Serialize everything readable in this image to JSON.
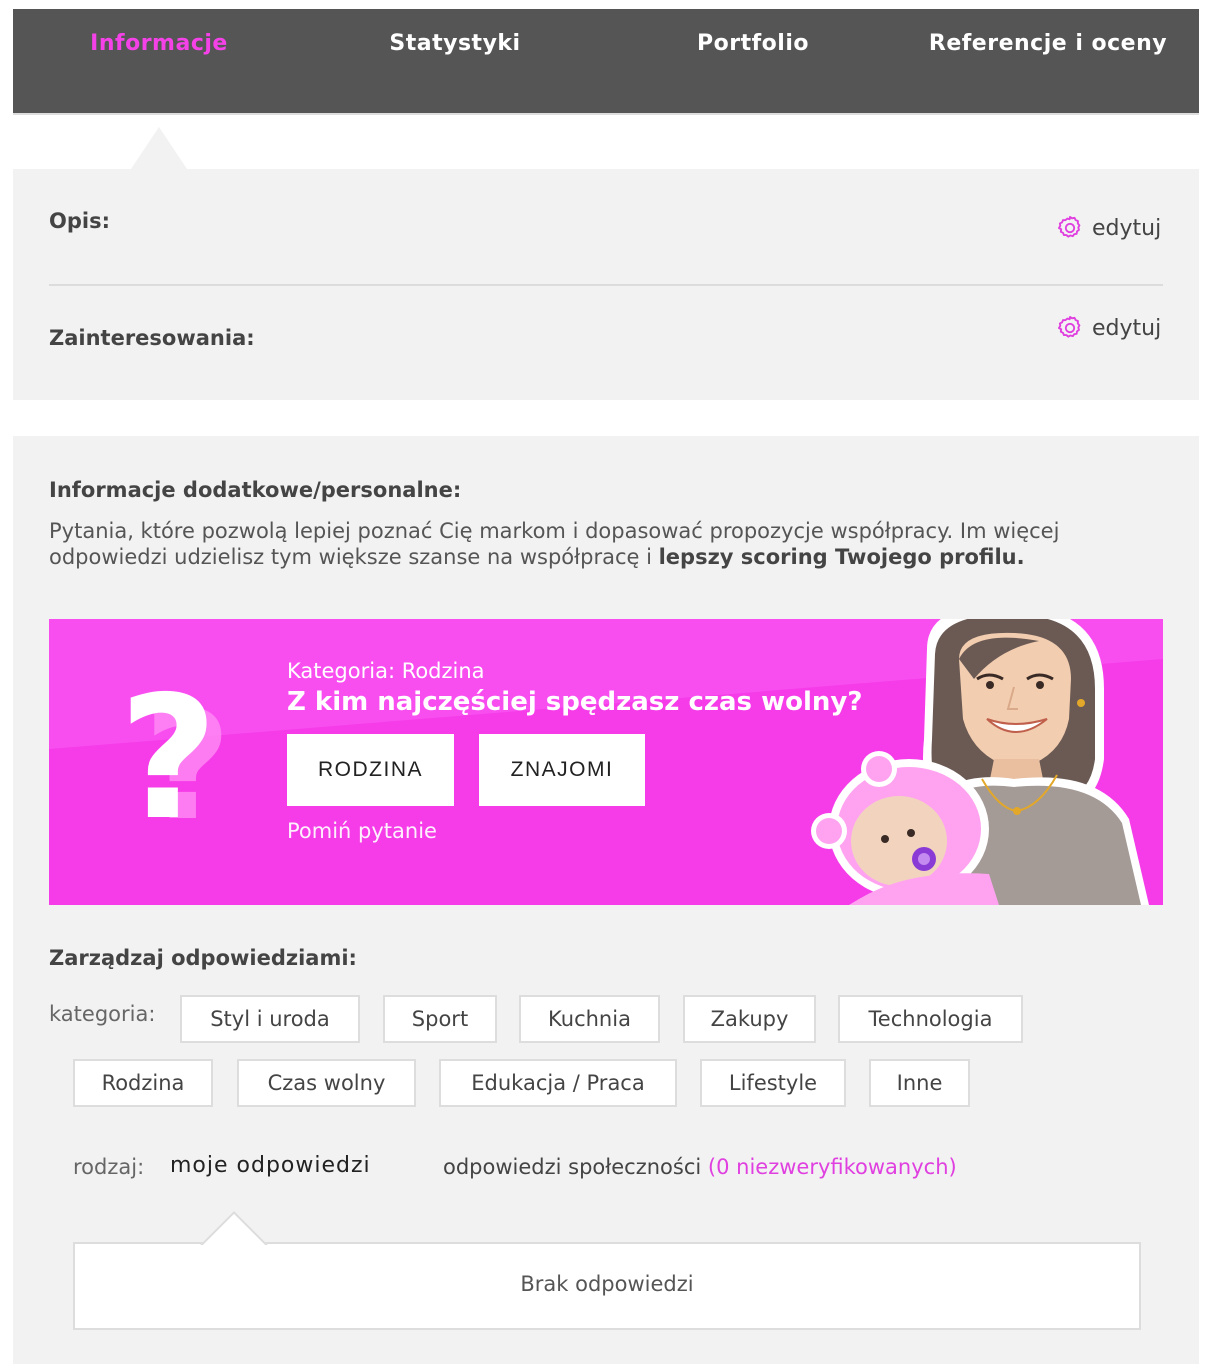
{
  "nav": {
    "tabs": [
      {
        "label": "Informacje",
        "active": true
      },
      {
        "label": "Statystyki",
        "active": false
      },
      {
        "label": "Portfolio",
        "active": false
      },
      {
        "label": "Referencje i oceny",
        "active": false
      }
    ]
  },
  "profile": {
    "opis_label": "Opis:",
    "zainteresowania_label": "Zainteresowania:",
    "edit_label": "edytuj"
  },
  "extra": {
    "title": "Informacje dodatkowe/personalne:",
    "desc_main": "Pytania, które pozwolą lepiej poznać Cię markom i dopasować propozycje współpracy. Im więcej odpowiedzi udzielisz tym większe szanse na współpracę i ",
    "desc_bold": "lepszy scoring Twojego profilu."
  },
  "banner": {
    "question_mark": "?",
    "category": "Kategoria: Rodzina",
    "question": "Z kim najczęściej spędzasz czas wolny?",
    "answer1": "RODZINA",
    "answer2": "ZNAJOMI",
    "skip": "Pomiń pytanie"
  },
  "manage": {
    "title": "Zarządzaj odpowiedziami:",
    "category_label": "kategoria:",
    "categories": [
      "Styl i uroda",
      "Sport",
      "Kuchnia",
      "Zakupy",
      "Technologia",
      "Rodzina",
      "Czas wolny",
      "Edukacja / Praca",
      "Lifestyle",
      "Inne"
    ],
    "kind_label": "rodzaj:",
    "kind_mine": "moje odpowiedzi",
    "kind_community": "odpowiedzi społeczności",
    "unverified": "(0 niezweryfikowanych)",
    "empty": "Brak odpowiedzi"
  },
  "colors": {
    "accent": "#f542e8",
    "nav_bg": "#555556",
    "panel_bg": "#f2f2f2",
    "banner_bg": "#f53ce8"
  }
}
